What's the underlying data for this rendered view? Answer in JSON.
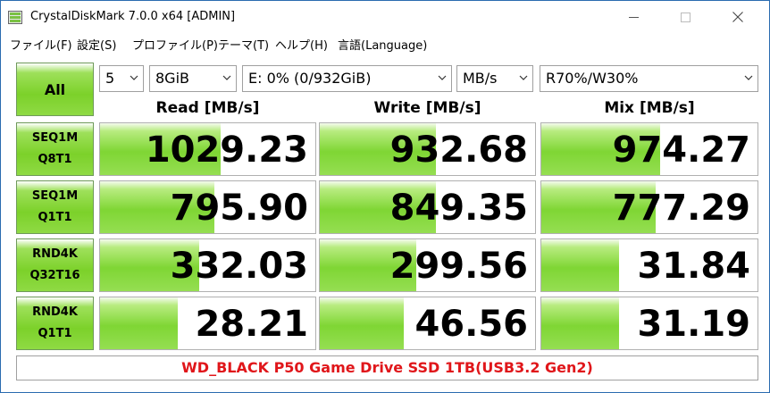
{
  "window": {
    "title": "CrystalDiskMark 7.0.0 x64 [ADMIN]"
  },
  "menu": [
    "ファイル(F)",
    "設定(S)",
    "プロファイル(P)",
    "テーマ(T)",
    "ヘルプ(H)",
    "言語(Language)"
  ],
  "controls": {
    "all_label": "All",
    "count": "5",
    "size": "8GiB",
    "drive": "E: 0% (0/932GiB)",
    "unit": "MB/s",
    "mix": "R70%/W30%"
  },
  "headers": {
    "read": "Read [MB/s]",
    "write": "Write [MB/s]",
    "mix": "Mix [MB/s]"
  },
  "rows": [
    {
      "l1": "SEQ1M",
      "l2": "Q8T1",
      "read": "1029.23",
      "write": "932.68",
      "mix": "974.27",
      "read_level": 0.56,
      "write_level": 0.54,
      "mix_level": 0.55
    },
    {
      "l1": "SEQ1M",
      "l2": "Q1T1",
      "read": "795.90",
      "write": "849.35",
      "mix": "777.29",
      "read_level": 0.53,
      "write_level": 0.54,
      "mix_level": 0.53
    },
    {
      "l1": "RND4K",
      "l2": "Q32T16",
      "read": "332.03",
      "write": "299.56",
      "mix": "31.84",
      "read_level": 0.46,
      "write_level": 0.45,
      "mix_level": 0.36
    },
    {
      "l1": "RND4K",
      "l2": "Q1T1",
      "read": "28.21",
      "write": "46.56",
      "mix": "31.19",
      "read_level": 0.36,
      "write_level": 0.39,
      "mix_level": 0.36
    }
  ],
  "footer": "WD_BLACK P50 Game Drive SSD 1TB(USB3.2 Gen2)"
}
